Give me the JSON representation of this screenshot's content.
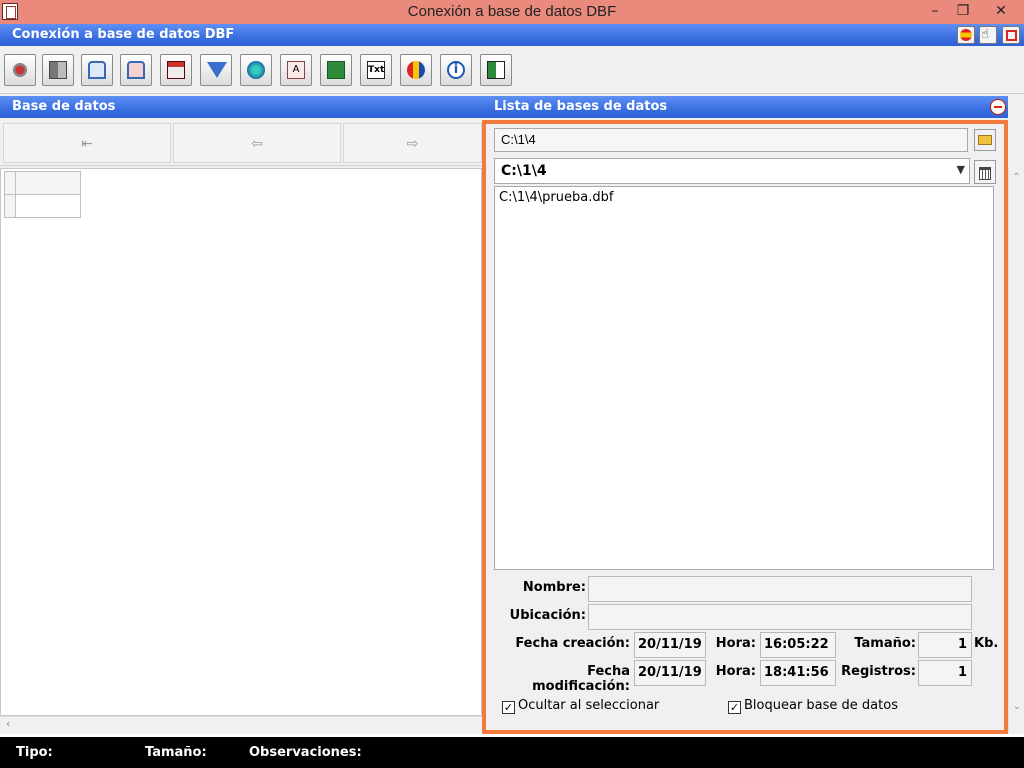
{
  "window": {
    "title": "Conexión a base de datos DBF",
    "controls": {
      "minimize": "–",
      "restore": "❐",
      "close": "✕"
    }
  },
  "app_header": {
    "title": "Conexión a base de datos DBF"
  },
  "toolbar": {
    "buttons": [
      {
        "name": "connect-icon"
      },
      {
        "name": "grid-icon"
      },
      {
        "name": "db-open-icon"
      },
      {
        "name": "db-export-icon"
      },
      {
        "name": "delete-icon"
      },
      {
        "name": "filter-icon"
      },
      {
        "name": "globe-icon"
      },
      {
        "name": "font-icon"
      },
      {
        "name": "excel-icon"
      },
      {
        "name": "txt-icon"
      },
      {
        "name": "flags-icon"
      },
      {
        "name": "info-icon"
      },
      {
        "name": "exit-icon"
      }
    ],
    "txt_label": "Txt",
    "info_label": "i"
  },
  "left_panel": {
    "title": "Base de datos",
    "nav": {
      "first": "⇤",
      "prev": "⇦",
      "next": "⇨"
    }
  },
  "right_panel": {
    "title": "Lista de bases de datos",
    "path_value": "C:\\1\\4",
    "combo_value": "C:\\1\\4",
    "files": [
      "C:\\1\\4\\prueba.dbf"
    ],
    "labels": {
      "nombre": "Nombre:",
      "ubicacion": "Ubicación:",
      "fecha_creacion": "Fecha creación:",
      "fecha_modificacion": "Fecha modificación:",
      "hora": "Hora:",
      "tamano": "Tamaño:",
      "registros": "Registros:",
      "kb": "Kb."
    },
    "values": {
      "nombre": "",
      "ubicacion": "",
      "fecha_creacion": "20/11/19",
      "hora_creacion": "16:05:22",
      "tamano": "1",
      "fecha_modificacion": "20/11/19",
      "hora_modificacion": "18:41:56",
      "registros": "1"
    },
    "checkboxes": {
      "ocultar": {
        "label": "Ocultar al seleccionar",
        "checked": true
      },
      "bloquear": {
        "label": "Bloquear base de datos",
        "checked": true
      }
    }
  },
  "statusbar": {
    "tipo": "Tipo:",
    "tamano": "Tamaño:",
    "observaciones": "Observaciones:"
  },
  "colors": {
    "titlebar": "#e98a7d",
    "header_blue": "#3a6fe0",
    "panel_border": "#f07b3c",
    "status_bg": "#000000"
  }
}
